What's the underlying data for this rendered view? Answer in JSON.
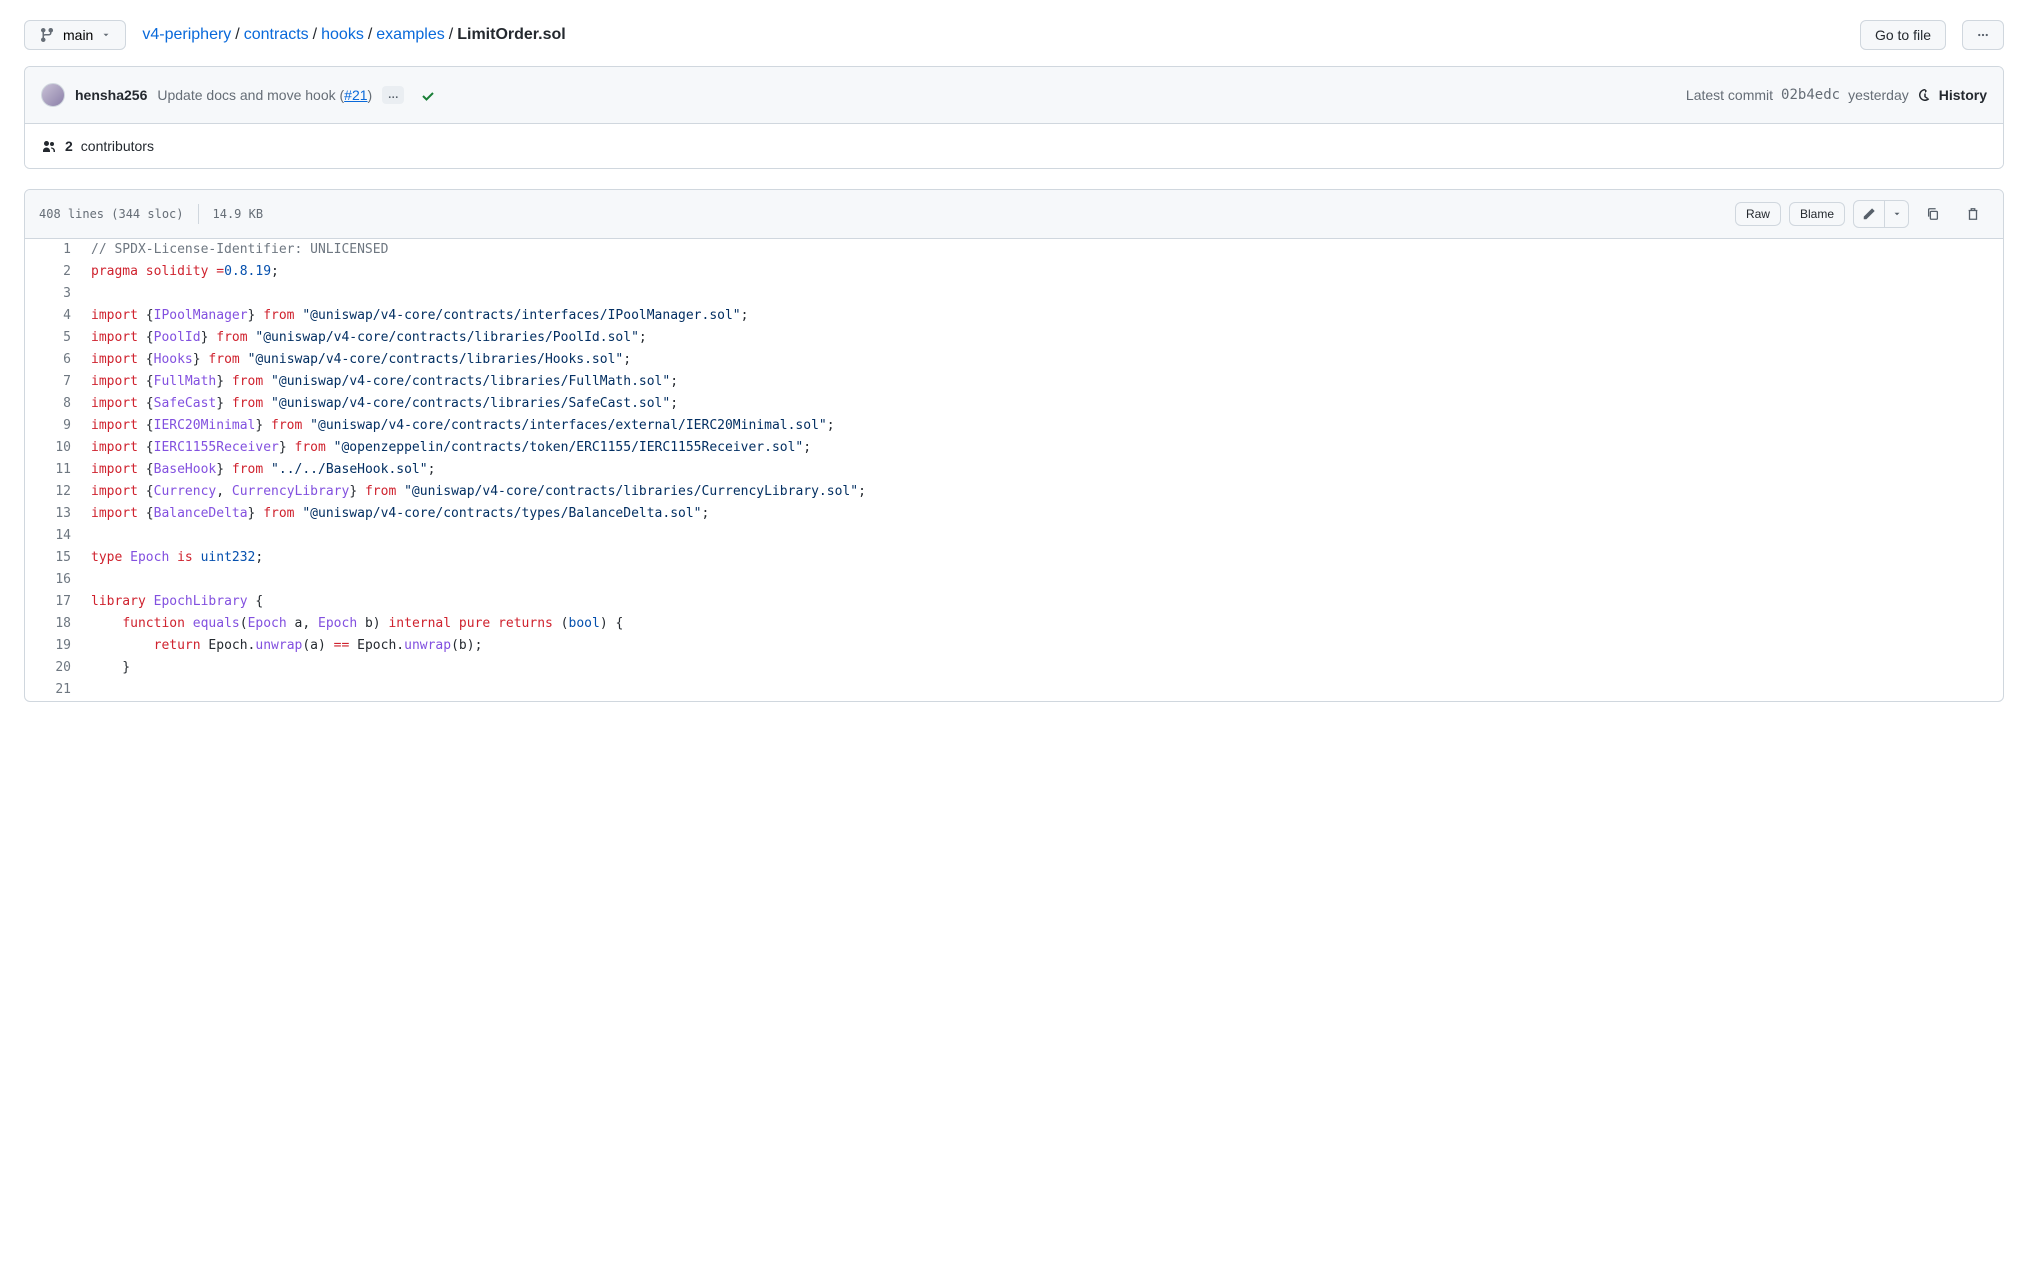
{
  "branch": {
    "label": "main"
  },
  "breadcrumb": {
    "parts": [
      "v4-periphery",
      "contracts",
      "hooks",
      "examples"
    ],
    "current": "LimitOrder.sol"
  },
  "actions": {
    "go_to_file": "Go to file"
  },
  "commit": {
    "author": "hensha256",
    "message_prefix": "Update docs and move hook (",
    "pr": "#21",
    "message_suffix": ")",
    "latest_label": "Latest commit",
    "sha": "02b4edc",
    "time": "yesterday",
    "history_label": "History"
  },
  "contributors": {
    "count": "2",
    "label": "contributors"
  },
  "file": {
    "stats_left": "408 lines (344 sloc)",
    "stats_right": "14.9 KB",
    "raw": "Raw",
    "blame": "Blame"
  },
  "code": [
    {
      "n": 1,
      "t": [
        [
          "c",
          "// SPDX-License-Identifier: UNLICENSED"
        ]
      ]
    },
    {
      "n": 2,
      "t": [
        [
          "k",
          "pragma"
        ],
        [
          "",
          " "
        ],
        [
          "k",
          "solidity"
        ],
        [
          "",
          " "
        ],
        [
          "k",
          "="
        ],
        [
          "nu",
          "0.8.19"
        ],
        [
          "",
          ";"
        ]
      ]
    },
    {
      "n": 3,
      "t": [
        [
          "",
          ""
        ]
      ]
    },
    {
      "n": 4,
      "t": [
        [
          "k",
          "import"
        ],
        [
          "",
          " {"
        ],
        [
          "n",
          "IPoolManager"
        ],
        [
          "",
          "} "
        ],
        [
          "k",
          "from"
        ],
        [
          "",
          " "
        ],
        [
          "s",
          "\"@uniswap/v4-core/contracts/interfaces/IPoolManager.sol\""
        ],
        [
          "",
          ";"
        ]
      ]
    },
    {
      "n": 5,
      "t": [
        [
          "k",
          "import"
        ],
        [
          "",
          " {"
        ],
        [
          "n",
          "PoolId"
        ],
        [
          "",
          "} "
        ],
        [
          "k",
          "from"
        ],
        [
          "",
          " "
        ],
        [
          "s",
          "\"@uniswap/v4-core/contracts/libraries/PoolId.sol\""
        ],
        [
          "",
          ";"
        ]
      ]
    },
    {
      "n": 6,
      "t": [
        [
          "k",
          "import"
        ],
        [
          "",
          " {"
        ],
        [
          "n",
          "Hooks"
        ],
        [
          "",
          "} "
        ],
        [
          "k",
          "from"
        ],
        [
          "",
          " "
        ],
        [
          "s",
          "\"@uniswap/v4-core/contracts/libraries/Hooks.sol\""
        ],
        [
          "",
          ";"
        ]
      ]
    },
    {
      "n": 7,
      "t": [
        [
          "k",
          "import"
        ],
        [
          "",
          " {"
        ],
        [
          "n",
          "FullMath"
        ],
        [
          "",
          "} "
        ],
        [
          "k",
          "from"
        ],
        [
          "",
          " "
        ],
        [
          "s",
          "\"@uniswap/v4-core/contracts/libraries/FullMath.sol\""
        ],
        [
          "",
          ";"
        ]
      ]
    },
    {
      "n": 8,
      "t": [
        [
          "k",
          "import"
        ],
        [
          "",
          " {"
        ],
        [
          "n",
          "SafeCast"
        ],
        [
          "",
          "} "
        ],
        [
          "k",
          "from"
        ],
        [
          "",
          " "
        ],
        [
          "s",
          "\"@uniswap/v4-core/contracts/libraries/SafeCast.sol\""
        ],
        [
          "",
          ";"
        ]
      ]
    },
    {
      "n": 9,
      "t": [
        [
          "k",
          "import"
        ],
        [
          "",
          " {"
        ],
        [
          "n",
          "IERC20Minimal"
        ],
        [
          "",
          "} "
        ],
        [
          "k",
          "from"
        ],
        [
          "",
          " "
        ],
        [
          "s",
          "\"@uniswap/v4-core/contracts/interfaces/external/IERC20Minimal.sol\""
        ],
        [
          "",
          ";"
        ]
      ]
    },
    {
      "n": 10,
      "t": [
        [
          "k",
          "import"
        ],
        [
          "",
          " {"
        ],
        [
          "n",
          "IERC1155Receiver"
        ],
        [
          "",
          "} "
        ],
        [
          "k",
          "from"
        ],
        [
          "",
          " "
        ],
        [
          "s",
          "\"@openzeppelin/contracts/token/ERC1155/IERC1155Receiver.sol\""
        ],
        [
          "",
          ";"
        ]
      ]
    },
    {
      "n": 11,
      "t": [
        [
          "k",
          "import"
        ],
        [
          "",
          " {"
        ],
        [
          "n",
          "BaseHook"
        ],
        [
          "",
          "} "
        ],
        [
          "k",
          "from"
        ],
        [
          "",
          " "
        ],
        [
          "s",
          "\"../../BaseHook.sol\""
        ],
        [
          "",
          ";"
        ]
      ]
    },
    {
      "n": 12,
      "t": [
        [
          "k",
          "import"
        ],
        [
          "",
          " {"
        ],
        [
          "n",
          "Currency"
        ],
        [
          "",
          ", "
        ],
        [
          "n",
          "CurrencyLibrary"
        ],
        [
          "",
          "} "
        ],
        [
          "k",
          "from"
        ],
        [
          "",
          " "
        ],
        [
          "s",
          "\"@uniswap/v4-core/contracts/libraries/CurrencyLibrary.sol\""
        ],
        [
          "",
          ";"
        ]
      ]
    },
    {
      "n": 13,
      "t": [
        [
          "k",
          "import"
        ],
        [
          "",
          " {"
        ],
        [
          "n",
          "BalanceDelta"
        ],
        [
          "",
          "} "
        ],
        [
          "k",
          "from"
        ],
        [
          "",
          " "
        ],
        [
          "s",
          "\"@uniswap/v4-core/contracts/types/BalanceDelta.sol\""
        ],
        [
          "",
          ";"
        ]
      ]
    },
    {
      "n": 14,
      "t": [
        [
          "",
          ""
        ]
      ]
    },
    {
      "n": 15,
      "t": [
        [
          "k",
          "type"
        ],
        [
          "",
          " "
        ],
        [
          "n",
          "Epoch"
        ],
        [
          "",
          " "
        ],
        [
          "k",
          "is"
        ],
        [
          "",
          " "
        ],
        [
          "kt",
          "uint232"
        ],
        [
          "",
          ";"
        ]
      ]
    },
    {
      "n": 16,
      "t": [
        [
          "",
          ""
        ]
      ]
    },
    {
      "n": 17,
      "t": [
        [
          "k",
          "library"
        ],
        [
          "",
          " "
        ],
        [
          "n",
          "EpochLibrary"
        ],
        [
          "",
          " {"
        ]
      ]
    },
    {
      "n": 18,
      "t": [
        [
          "",
          "    "
        ],
        [
          "k",
          "function"
        ],
        [
          "",
          " "
        ],
        [
          "n",
          "equals"
        ],
        [
          "",
          "("
        ],
        [
          "n",
          "Epoch"
        ],
        [
          "",
          " a, "
        ],
        [
          "n",
          "Epoch"
        ],
        [
          "",
          " b) "
        ],
        [
          "k",
          "internal"
        ],
        [
          "",
          " "
        ],
        [
          "k",
          "pure"
        ],
        [
          "",
          " "
        ],
        [
          "k",
          "returns"
        ],
        [
          "",
          " ("
        ],
        [
          "kt",
          "bool"
        ],
        [
          "",
          ") {"
        ]
      ]
    },
    {
      "n": 19,
      "t": [
        [
          "",
          "        "
        ],
        [
          "k",
          "return"
        ],
        [
          "",
          " Epoch."
        ],
        [
          "n",
          "unwrap"
        ],
        [
          "",
          "(a) "
        ],
        [
          "k",
          "=="
        ],
        [
          "",
          " Epoch."
        ],
        [
          "n",
          "unwrap"
        ],
        [
          "",
          "(b);"
        ]
      ]
    },
    {
      "n": 20,
      "t": [
        [
          "",
          "    }"
        ]
      ]
    },
    {
      "n": 21,
      "t": [
        [
          "",
          ""
        ]
      ]
    }
  ]
}
